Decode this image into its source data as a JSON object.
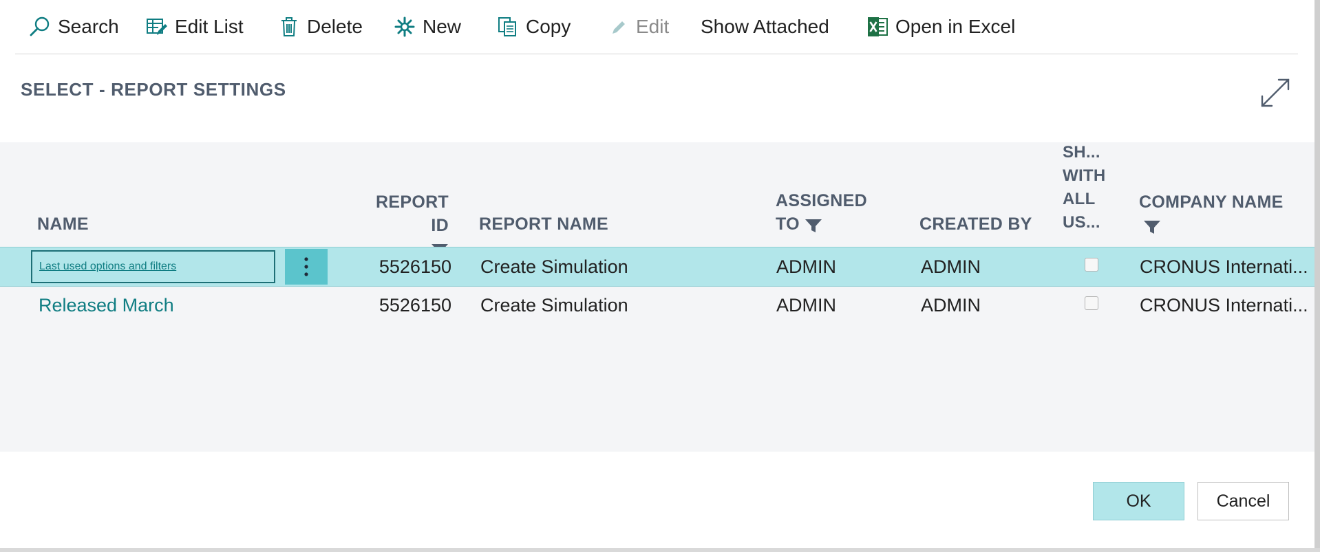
{
  "toolbar": {
    "search": "Search",
    "edit_list": "Edit List",
    "delete": "Delete",
    "new": "New",
    "copy": "Copy",
    "edit": "Edit",
    "show_attached": "Show Attached",
    "open_in_excel": "Open in Excel"
  },
  "page": {
    "title": "SELECT - REPORT SETTINGS"
  },
  "columns": {
    "name": "NAME",
    "report_id": "REPORT ID",
    "report_name": "REPORT NAME",
    "assigned_to_1": "ASSIGNED",
    "assigned_to_2": "TO",
    "created_by": "CREATED BY",
    "shared_1": "SH...",
    "shared_2": "WITH",
    "shared_3": "ALL",
    "shared_4": "US...",
    "company_name": "COMPANY NAME"
  },
  "rows": [
    {
      "name": "Last used options and filters",
      "report_id": "5526150",
      "report_name": "Create Simulation",
      "assigned_to": "ADMIN",
      "created_by": "ADMIN",
      "shared": false,
      "company": "CRONUS Internati..."
    },
    {
      "name": "Released March",
      "report_id": "5526150",
      "report_name": "Create Simulation",
      "assigned_to": "ADMIN",
      "created_by": "ADMIN",
      "shared": false,
      "company": "CRONUS Internati..."
    }
  ],
  "buttons": {
    "ok": "OK",
    "cancel": "Cancel"
  },
  "colors": {
    "accent": "#0f7d82",
    "selected_row": "#b2e6ea",
    "excel_green": "#1e7145"
  },
  "icons": [
    "search-icon",
    "edit-list-icon",
    "delete-icon",
    "new-icon",
    "copy-icon",
    "edit-icon",
    "excel-icon",
    "expand-icon",
    "filter-icon",
    "more-options-icon"
  ]
}
